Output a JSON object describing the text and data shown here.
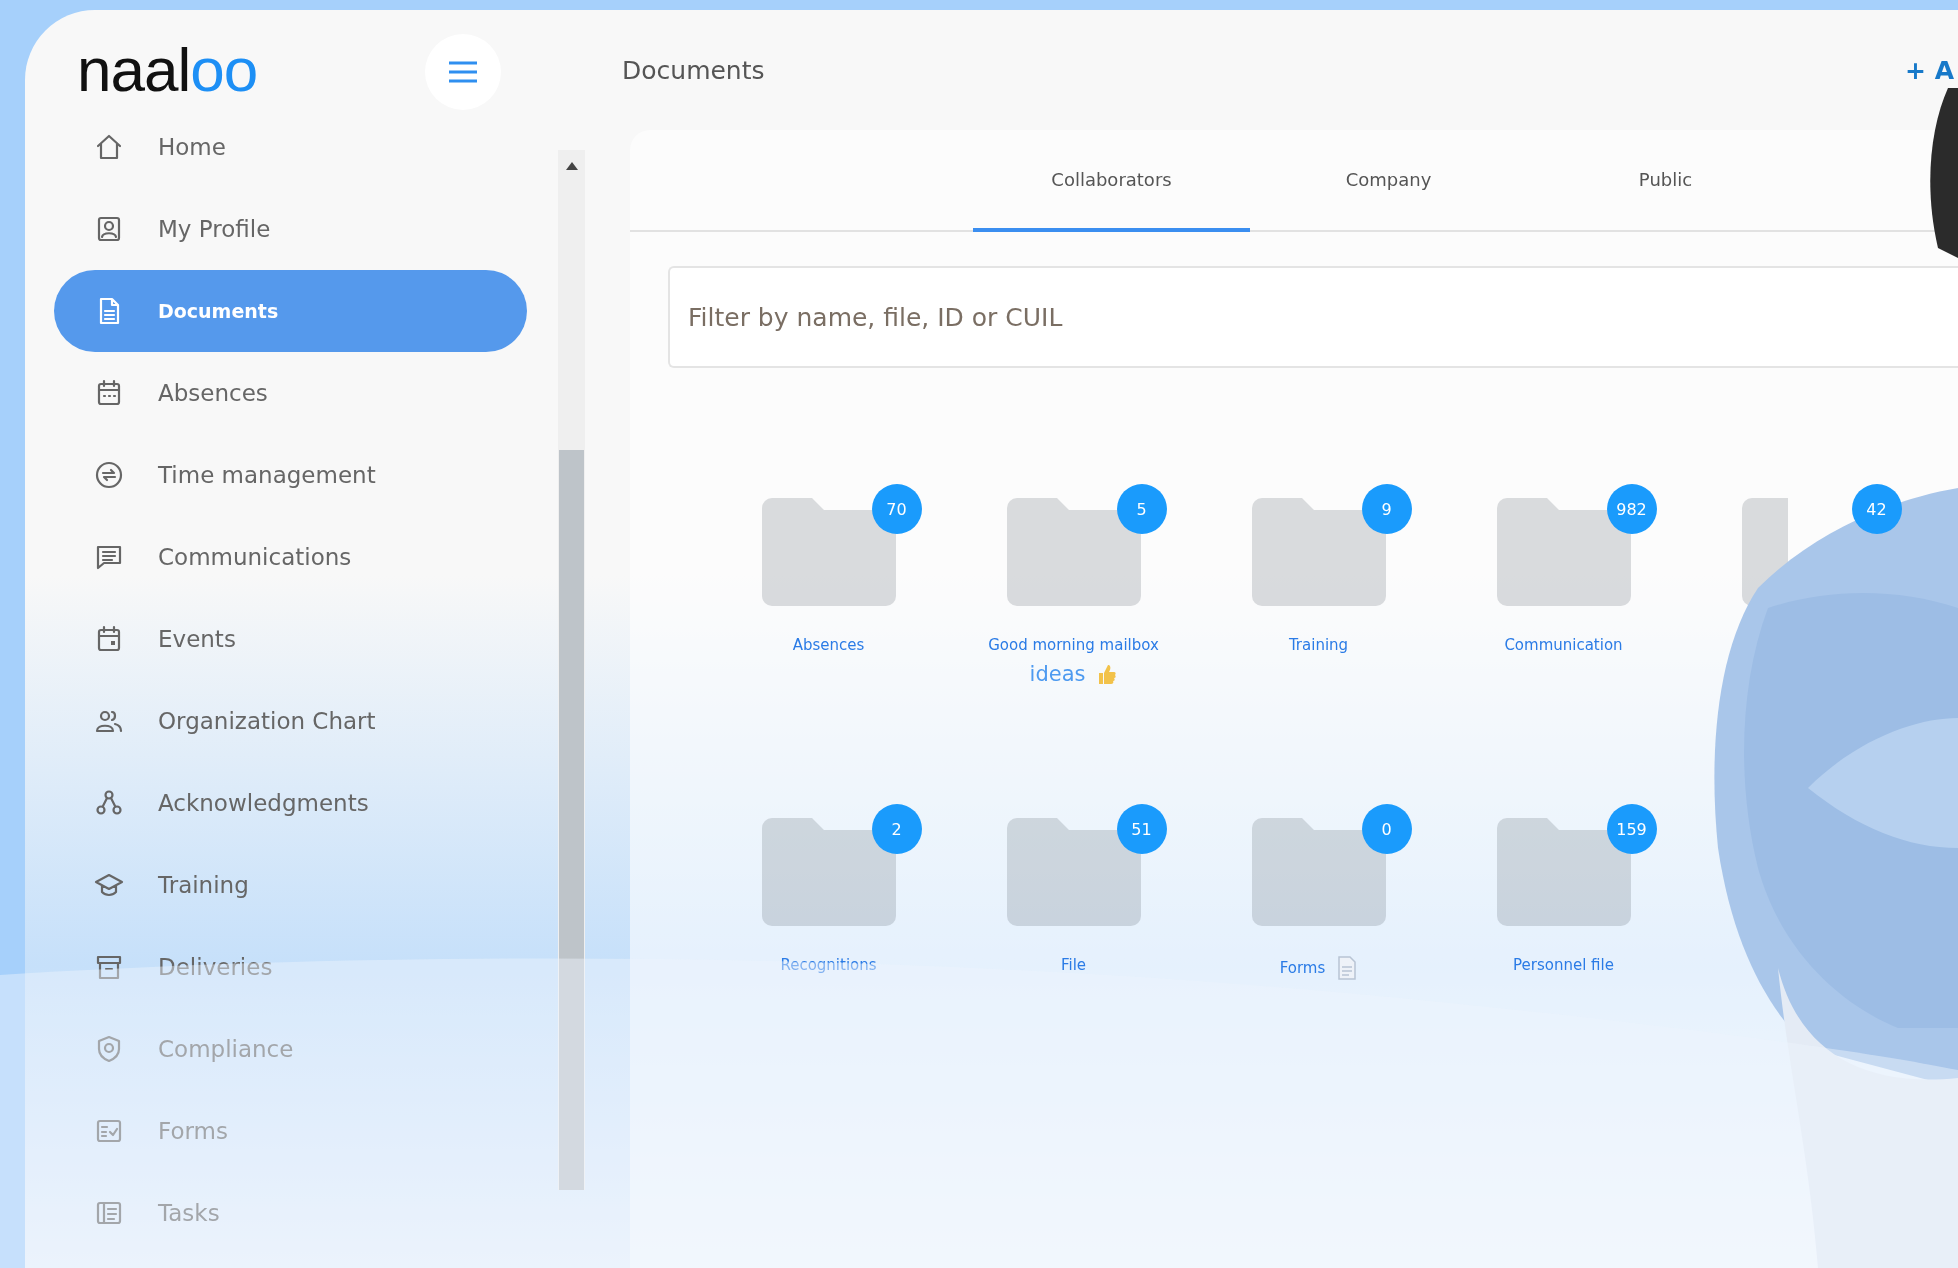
{
  "logo": {
    "text": "naal",
    "accent": "oo"
  },
  "header": {
    "title": "Documents",
    "action": "+ A"
  },
  "sidebar": {
    "items": [
      {
        "label": "Home",
        "selected": false
      },
      {
        "label": "My Profile",
        "selected": false
      },
      {
        "label": "Documents",
        "selected": true
      },
      {
        "label": "Absences",
        "selected": false
      },
      {
        "label": "Time management",
        "selected": false
      },
      {
        "label": "Communications",
        "selected": false
      },
      {
        "label": "Events",
        "selected": false
      },
      {
        "label": "Organization Chart",
        "selected": false
      },
      {
        "label": "Acknowledgments",
        "selected": false
      },
      {
        "label": "Training",
        "selected": false
      },
      {
        "label": "Deliveries",
        "selected": false
      },
      {
        "label": "Compliance",
        "selected": false
      },
      {
        "label": "Forms",
        "selected": false
      },
      {
        "label": "Tasks",
        "selected": false
      }
    ]
  },
  "tabs": [
    {
      "label": "Collaborators",
      "selected": true
    },
    {
      "label": "Company",
      "selected": false
    },
    {
      "label": "Public",
      "selected": false
    }
  ],
  "search": {
    "placeholder": "Filter by name, file, ID or CUIL"
  },
  "folders": [
    {
      "count": "70",
      "label": "Absences",
      "kind": "plain"
    },
    {
      "count": "5",
      "label": "Good morning mailbox",
      "note": "ideas",
      "kind": "note"
    },
    {
      "count": "9",
      "label": "Training",
      "kind": "plain"
    },
    {
      "count": "982",
      "label": "Communication",
      "kind": "plain"
    },
    {
      "count": "42",
      "kind": "hidden"
    },
    {
      "count": "2",
      "label": "Recognitions",
      "kind": "plain"
    },
    {
      "count": "51",
      "label": "File",
      "kind": "plain"
    },
    {
      "count": "0",
      "label": "Forms",
      "kind": "attached"
    },
    {
      "count": "159",
      "label": "Personnel file",
      "kind": "plain"
    }
  ]
}
